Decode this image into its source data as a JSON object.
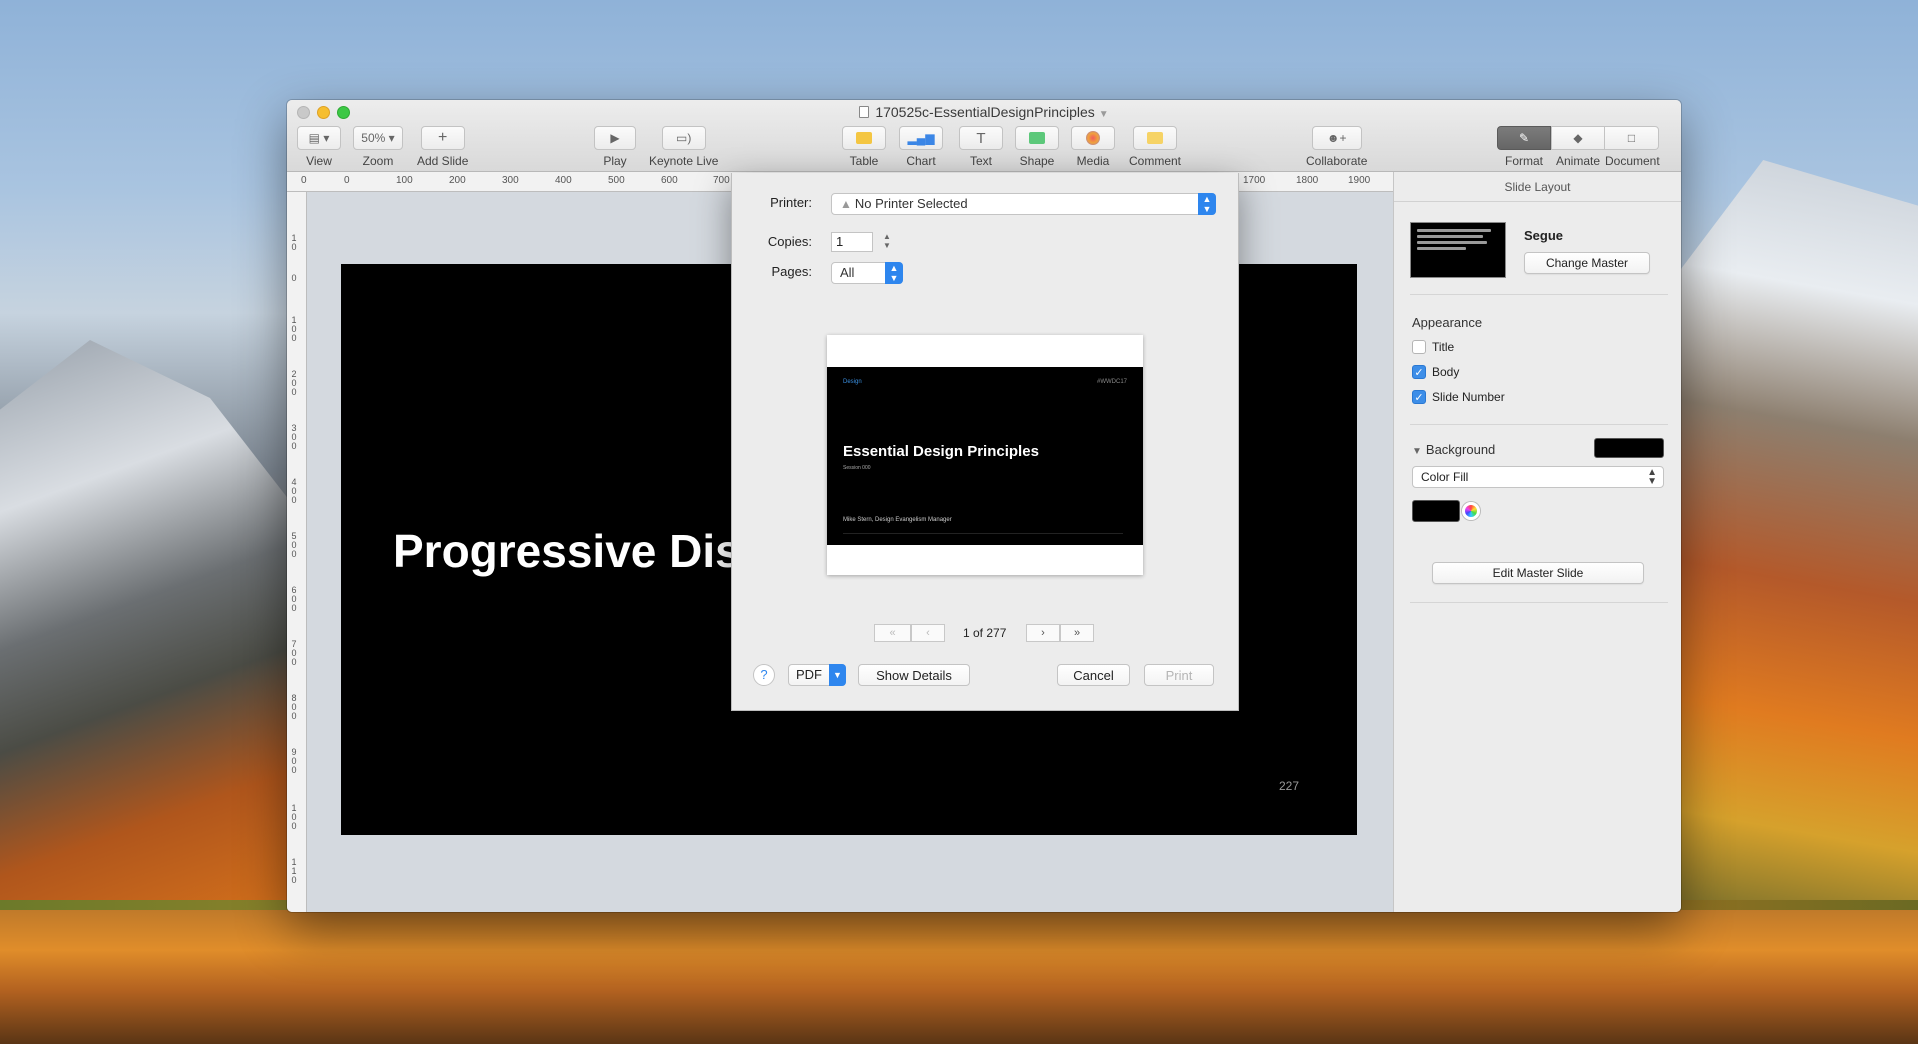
{
  "window": {
    "title": "170525c-EssentialDesignPrinciples"
  },
  "toolbar": {
    "view": {
      "label": "View",
      "icon": "sidebar-icon"
    },
    "zoom": {
      "label": "Zoom",
      "value": "50%"
    },
    "add_slide": {
      "label": "Add Slide",
      "icon": "plus-icon"
    },
    "play": {
      "label": "Play",
      "icon": "play-icon"
    },
    "keynote_live": {
      "label": "Keynote Live",
      "icon": "keynote-live-icon"
    },
    "table": {
      "label": "Table",
      "icon": "table-icon"
    },
    "chart": {
      "label": "Chart",
      "icon": "chart-icon"
    },
    "text": {
      "label": "Text",
      "icon": "text-icon"
    },
    "shape": {
      "label": "Shape",
      "icon": "shape-icon"
    },
    "media": {
      "label": "Media",
      "icon": "media-icon"
    },
    "comment": {
      "label": "Comment",
      "icon": "comment-icon"
    },
    "collaborate": {
      "label": "Collaborate",
      "icon": "collaborate-icon"
    },
    "format": {
      "label": "Format",
      "icon": "paintbrush-icon"
    },
    "animate": {
      "label": "Animate",
      "icon": "diamond-icon"
    },
    "document": {
      "label": "Document",
      "icon": "document-icon"
    }
  },
  "ruler": {
    "h_labels": [
      "0",
      "0",
      "100",
      "200",
      "300",
      "400",
      "500",
      "600",
      "700",
      "1700",
      "1800",
      "1900"
    ],
    "v_labels": [
      "1 0",
      "0",
      "1 0 0",
      "2 0 0",
      "3 0 0",
      "4 0 0",
      "5 0 0",
      "6 0 0",
      "7 0 0",
      "8 0 0",
      "9 0 0",
      "1 0 0",
      "1 1 0"
    ]
  },
  "slide": {
    "title": "Progressive Dis",
    "slide_number": "227"
  },
  "inspector": {
    "header": "Slide Layout",
    "master_name": "Segue",
    "change_master": "Change Master",
    "appearance_label": "Appearance",
    "checkboxes": [
      {
        "label": "Title",
        "checked": false
      },
      {
        "label": "Body",
        "checked": true
      },
      {
        "label": "Slide Number",
        "checked": true
      }
    ],
    "background_label": "Background",
    "background_color": "#000000",
    "fill_type": "Color Fill",
    "edit_master": "Edit Master Slide"
  },
  "print_dialog": {
    "printer_label": "Printer:",
    "printer_value": "No Printer Selected",
    "copies_label": "Copies:",
    "copies_value": "1",
    "pages_label": "Pages:",
    "pages_value": "All",
    "preview": {
      "tag_left": "Design",
      "tag_right": "#WWDC17",
      "title": "Essential Design Principles",
      "subtitle": "Session 000",
      "author": "Mike Stern, Design Evangelism Manager"
    },
    "page_indicator": "1 of 277",
    "help": "?",
    "pdf": "PDF",
    "show_details": "Show Details",
    "cancel": "Cancel",
    "print": "Print"
  }
}
